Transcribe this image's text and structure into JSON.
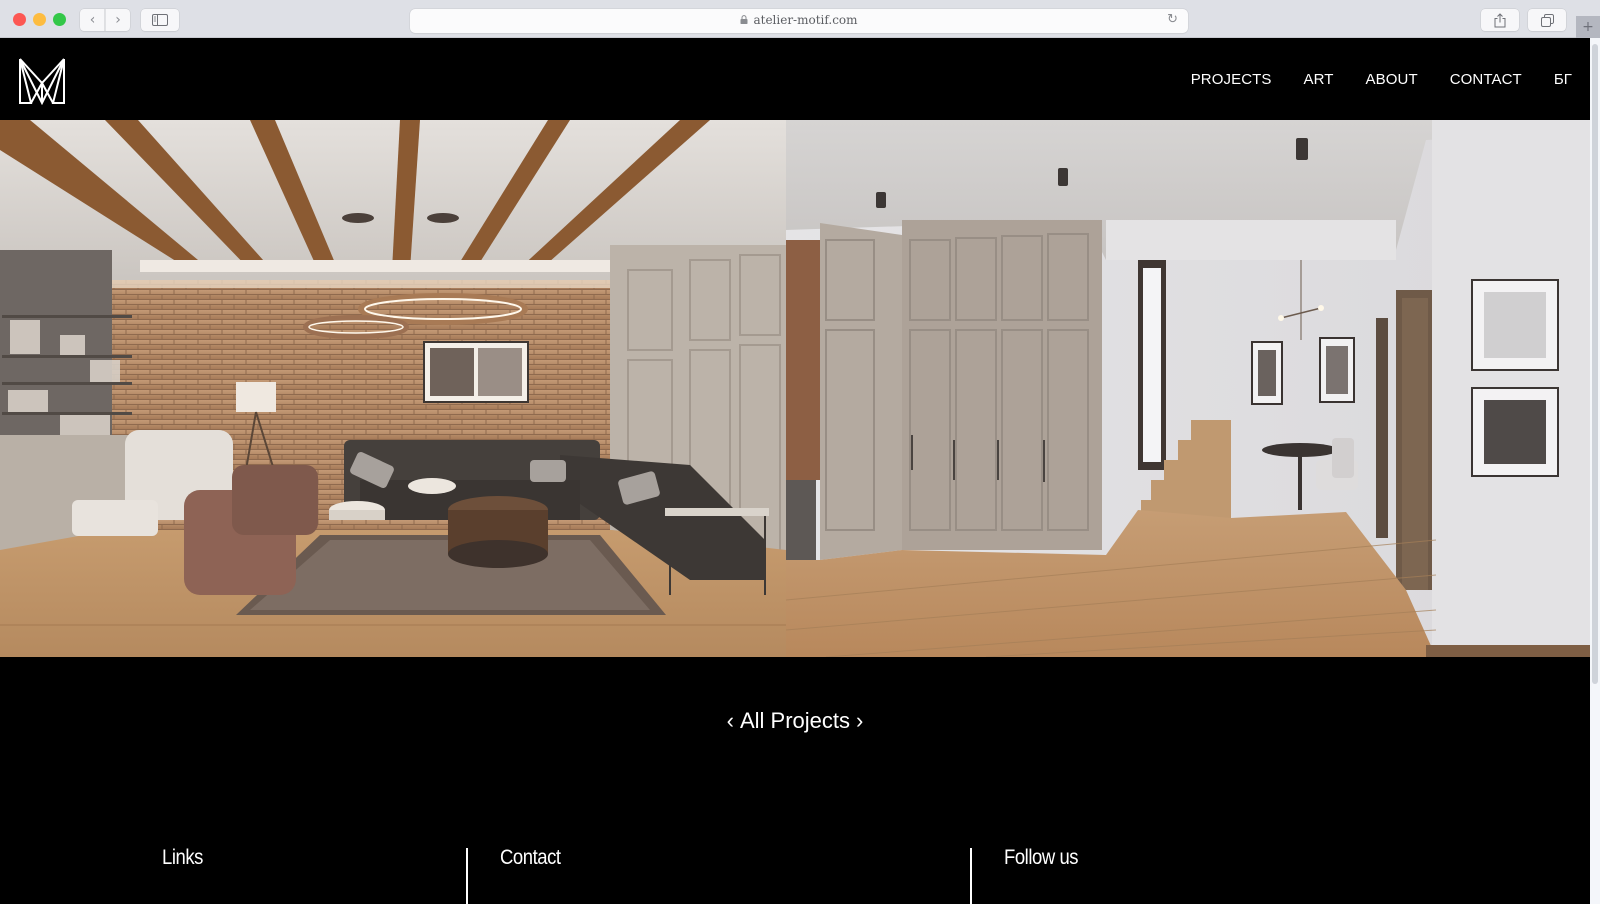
{
  "browser": {
    "url": "atelier-motif.com",
    "buttons": {
      "back": "‹",
      "forward": "›",
      "reload": "↻",
      "new_tab": "+"
    },
    "icons": [
      "lock-icon",
      "sidebar-icon",
      "share-icon",
      "tabs-icon",
      "reload-icon"
    ]
  },
  "site": {
    "logo_alt": "Atelier Motif logo",
    "nav": [
      {
        "label": "PROJECTS"
      },
      {
        "label": "ART"
      },
      {
        "label": "ABOUT"
      },
      {
        "label": "CONTACT"
      },
      {
        "label": "БГ"
      }
    ]
  },
  "gallery": {
    "images": [
      {
        "alt": "Living room with exposed wooden ceiling beams, brick wall, copper ring pendant light and dark sectional sofa"
      },
      {
        "alt": "Hallway with built-in beige wardrobes, wooden staircase and framed black-and-white art"
      }
    ]
  },
  "project_nav": {
    "prev": "‹",
    "label": "All Projects",
    "next": "›"
  },
  "footer": {
    "columns": [
      {
        "title": "Links"
      },
      {
        "title": "Contact"
      },
      {
        "title": "Follow us"
      }
    ]
  }
}
